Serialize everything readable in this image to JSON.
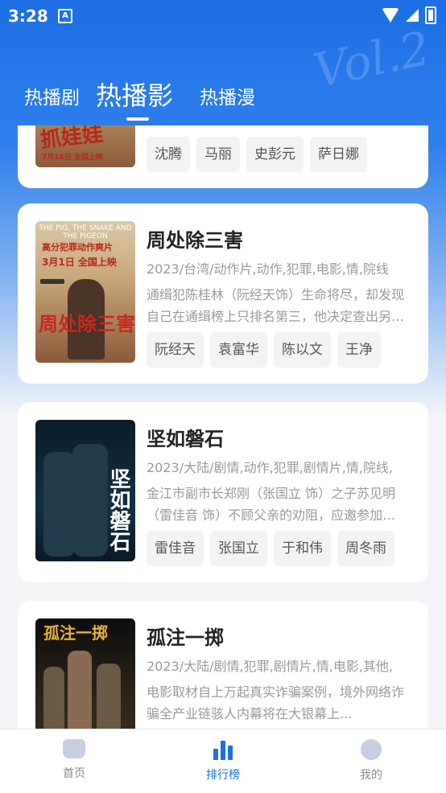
{
  "status_bar": {
    "time": "3:28",
    "notification": "A"
  },
  "tabs": [
    "热播剧",
    "热播影",
    "热播漫"
  ],
  "active_tab": 1,
  "cards": [
    {
      "poster_title": "抓娃娃",
      "poster_date": "7月16日 全国上映",
      "tags": [
        "沈腾",
        "马丽",
        "史彭元",
        "萨日娜"
      ]
    },
    {
      "title": "周处除三害",
      "meta": "2023/台湾/动作片,动作,犯罪,电影,情,院线",
      "desc": "通缉犯陈桂林（阮经天饰）生命将尽，却发现自己在通缉榜上只排名第三，他决定查出另外两个通缉犯的下落...",
      "tags": [
        "阮经天",
        "袁富华",
        "陈以文",
        "王净"
      ],
      "poster_head": "THE PIG, THE SNAKE AND THE PIGEON",
      "poster_sub": "高分犯罪动作爽片",
      "poster_date": "3月1日 全国上映",
      "poster_title": "周处除三害"
    },
    {
      "title": "坚如磐石",
      "meta": "2023/大陆/剧情,动作,犯罪,剧情片,情,院线,",
      "desc": "金江市副市长郑刚（张国立 饰）之子苏见明（雷佳音 饰）不顾父亲的劝阻，应邀参加一场宴会...",
      "tags": [
        "雷佳音",
        "张国立",
        "于和伟",
        "周冬雨"
      ],
      "poster_title": "坚如磐石"
    },
    {
      "title": "孤注一掷",
      "meta": "2023/大陆/剧情,犯罪,剧情片,情,电影,其他,",
      "desc": "电影取材自上万起真实诈骗案例，境外网络诈骗全产业链骇人内幕将在大银幕上...",
      "poster_title": "孤注一掷"
    }
  ],
  "bottom_nav": [
    {
      "label": "首页",
      "icon": "home-icon"
    },
    {
      "label": "排行榜",
      "icon": "ranking-icon"
    },
    {
      "label": "我的",
      "icon": "profile-icon"
    }
  ],
  "colors": {
    "accent": "#1d6fe3",
    "tag_bg": "#f2f3f5",
    "text_muted": "#9a9a9a"
  }
}
